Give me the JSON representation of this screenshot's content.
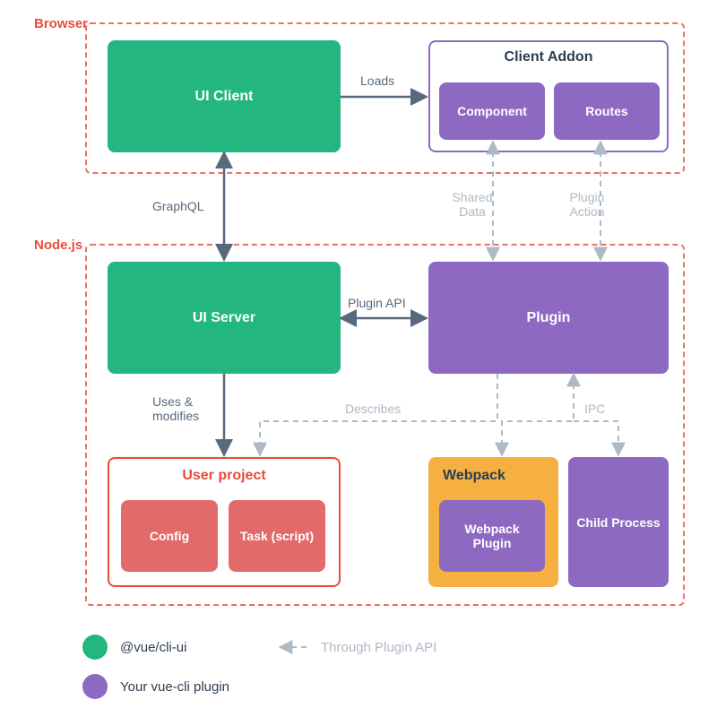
{
  "layers": {
    "browser": "Browser",
    "node": "Node.js"
  },
  "boxes": {
    "ui_client": "UI Client",
    "client_addon": "Client Addon",
    "component": "Component",
    "routes": "Routes",
    "ui_server": "UI Server",
    "plugin": "Plugin",
    "user_project": "User project",
    "config": "Config",
    "task": "Task (script)",
    "webpack": "Webpack",
    "webpack_plugin": "Webpack Plugin",
    "child_process": "Child Process"
  },
  "edges": {
    "loads": "Loads",
    "graphql": "GraphQL",
    "shared_data": "Shared Data",
    "plugin_action": "Plugin Action",
    "plugin_api": "Plugin API",
    "uses_modifies": "Uses & modifies",
    "describes": "Describes",
    "ipc": "IPC"
  },
  "legend": {
    "green": "@vue/cli-ui",
    "purple": "Your vue-cli plugin",
    "through": "Through Plugin API"
  },
  "colors": {
    "green": "#23b680",
    "purple": "#8e69c1",
    "red": "#e74c3c",
    "yellow": "#f5b041",
    "redfill": "#e26a6a",
    "soft": "#aeb9c4",
    "text": "#57697b"
  }
}
